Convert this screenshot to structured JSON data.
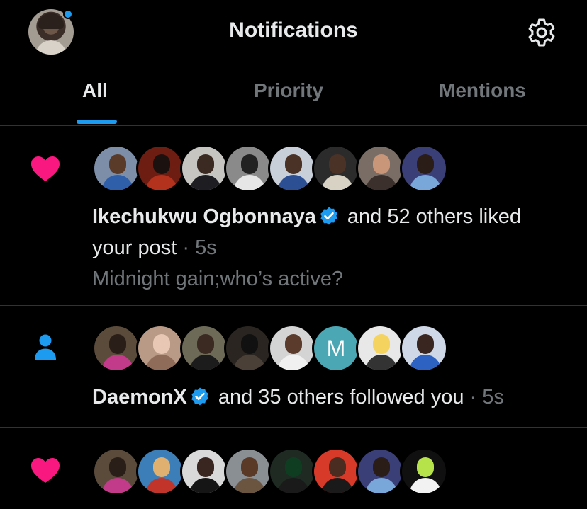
{
  "header": {
    "title": "Notifications",
    "avatar_icon": "profile-avatar",
    "settings_icon": "gear-icon"
  },
  "tabs": [
    {
      "label": "All",
      "active": true
    },
    {
      "label": "Priority",
      "active": false
    },
    {
      "label": "Mentions",
      "active": false
    }
  ],
  "colors": {
    "accent": "#1d9bf0",
    "like": "#f91880",
    "muted": "#71767b",
    "divider": "#2f3336"
  },
  "notifications": [
    {
      "type": "like",
      "icon": "heart-icon",
      "actor": "Ikechukwu Ogbonnaya",
      "actor_verified": true,
      "action": "and 52 others liked",
      "line2_text": "your post",
      "time": "· 5s",
      "preview": "Midnight gain;who’s active?"
    },
    {
      "type": "follow",
      "icon": "person-icon",
      "actor": "DaemonX",
      "actor_verified": true,
      "action": "and 35 others followed you",
      "time": "· 5s",
      "letter_avatar": "M"
    },
    {
      "type": "like",
      "icon": "heart-icon"
    }
  ]
}
